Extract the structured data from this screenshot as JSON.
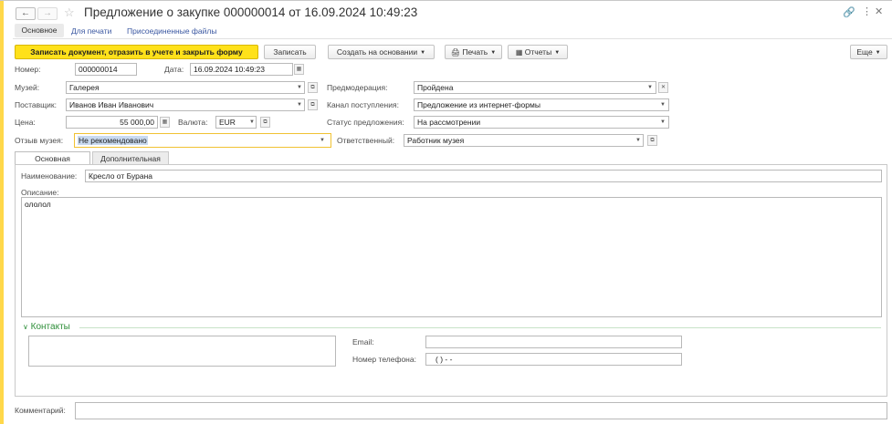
{
  "window": {
    "title": "Предложение о закупке 000000014 от 16.09.2024 10:49:23"
  },
  "nav_tabs": [
    "Основное",
    "Для печати",
    "Присоединенные файлы"
  ],
  "toolbar": {
    "post_close_label": "Записать документ, отразить в учете и закрыть форму",
    "save_label": "Записать",
    "create_based_label": "Создать на основании",
    "print_label": "Печать",
    "reports_label": "Отчеты",
    "more_label": "Еще"
  },
  "header_fields": {
    "number_label": "Номер:",
    "number_value": "000000014",
    "date_label": "Дата:",
    "date_value": "16.09.2024 10:49:23"
  },
  "left_fields": {
    "museum_label": "Музей:",
    "museum_value": "Галерея",
    "supplier_label": "Поставщик:",
    "supplier_value": "Иванов Иван Иванович",
    "price_label": "Цена:",
    "price_value": "55 000,00",
    "currency_label": "Валюта:",
    "currency_value": "EUR",
    "review_label": "Отзыв музея:",
    "review_value": "Не рекомендовано"
  },
  "right_fields": {
    "premoderation_label": "Предмодерация:",
    "premoderation_value": "Пройдена",
    "channel_label": "Канал поступления:",
    "channel_value": "Предложение из интернет-формы",
    "status_label": "Статус предложения:",
    "status_value": "На рассмотрении",
    "responsible_label": "Ответственный:",
    "responsible_value": "Работник музея"
  },
  "inner_tabs": [
    "Основная",
    "Дополнительная"
  ],
  "main_tab": {
    "name_label": "Наименование:",
    "name_value": "Кресло от Бурана",
    "description_label": "Описание:",
    "description_value": "ололол"
  },
  "contacts": {
    "group_label": "Контакты",
    "email_label": "Email:",
    "email_value": "",
    "phone_label": "Номер телефона:",
    "phone_value": "(    )    -   -"
  },
  "comment": {
    "label": "Комментарий:",
    "value": ""
  },
  "colors": {
    "accent_yellow": "#ffe11a",
    "link_blue": "#3a57a1",
    "group_green": "#2f8f3a",
    "focus_border": "#f1c232"
  }
}
